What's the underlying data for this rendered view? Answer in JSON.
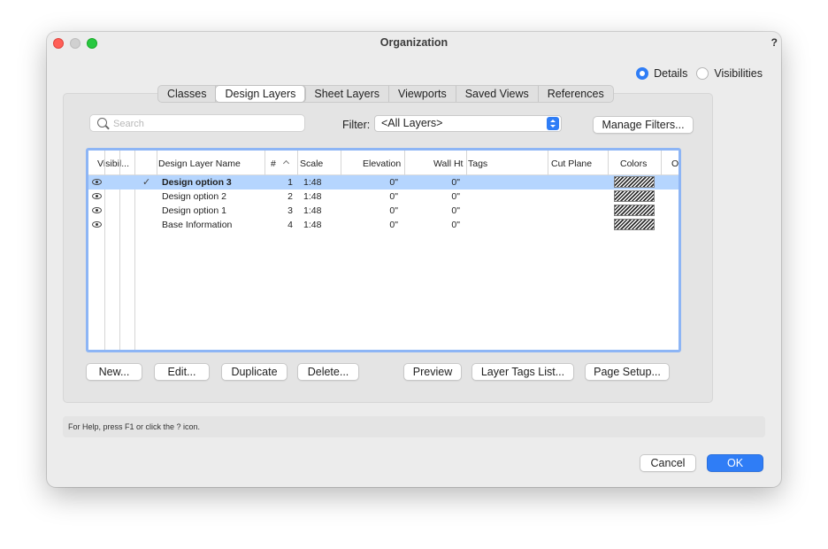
{
  "window": {
    "title": "Organization",
    "help_glyph": "?"
  },
  "view_mode": {
    "options": [
      {
        "label": "Details",
        "selected": true
      },
      {
        "label": "Visibilities",
        "selected": false
      }
    ]
  },
  "tabs": [
    {
      "label": "Classes",
      "active": false
    },
    {
      "label": "Design Layers",
      "active": true
    },
    {
      "label": "Sheet Layers",
      "active": false
    },
    {
      "label": "Viewports",
      "active": false
    },
    {
      "label": "Saved Views",
      "active": false
    },
    {
      "label": "References",
      "active": false
    }
  ],
  "search": {
    "placeholder": "Search",
    "value": ""
  },
  "filter": {
    "label": "Filter:",
    "selected": "<All Layers>"
  },
  "manage_filters_label": "Manage Filters...",
  "table": {
    "columns": [
      "Visibil...",
      "Design Layer Name",
      "#",
      "Scale",
      "Elevation",
      "Wall Ht",
      "Tags",
      "Cut Plane",
      "Colors",
      "O"
    ],
    "sort_column": "#",
    "rows": [
      {
        "visible": true,
        "active": true,
        "name": "Design option 3",
        "num": "1",
        "scale": "1:48",
        "elevation": "0\"",
        "wall_ht": "0\"",
        "tags": "",
        "cut_plane": "",
        "selected": true
      },
      {
        "visible": true,
        "active": false,
        "name": "Design option 2",
        "num": "2",
        "scale": "1:48",
        "elevation": "0\"",
        "wall_ht": "0\"",
        "tags": "",
        "cut_plane": "",
        "selected": false
      },
      {
        "visible": true,
        "active": false,
        "name": "Design option 1",
        "num": "3",
        "scale": "1:48",
        "elevation": "0\"",
        "wall_ht": "0\"",
        "tags": "",
        "cut_plane": "",
        "selected": false
      },
      {
        "visible": true,
        "active": false,
        "name": "Base Information",
        "num": "4",
        "scale": "1:48",
        "elevation": "0\"",
        "wall_ht": "0\"",
        "tags": "",
        "cut_plane": "",
        "selected": false
      }
    ]
  },
  "actions": {
    "new": "New...",
    "edit": "Edit...",
    "duplicate": "Duplicate",
    "delete": "Delete...",
    "preview": "Preview",
    "layer_tags": "Layer Tags List...",
    "page_setup": "Page Setup..."
  },
  "help_text": "For Help, press F1 or click the ? icon.",
  "footer": {
    "cancel": "Cancel",
    "ok": "OK"
  },
  "colors": {
    "accent": "#2f7df6",
    "selection": "#b5d5fe",
    "table_border": "#8db5f5"
  }
}
